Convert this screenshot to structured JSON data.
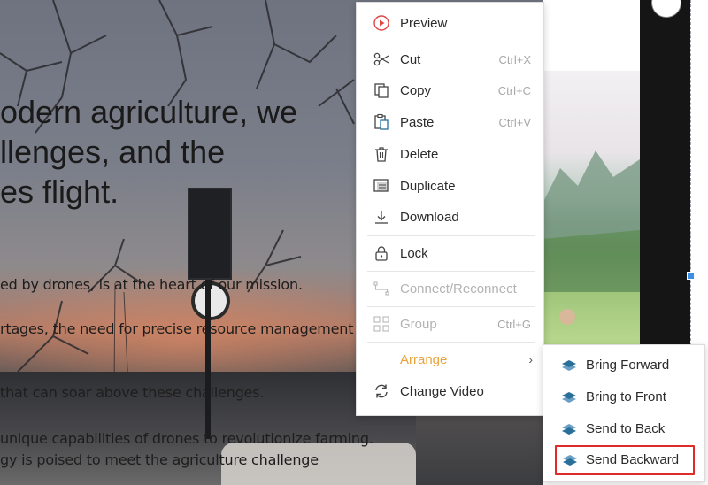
{
  "background": {
    "headline": [
      "odern agriculture, we",
      "llenges, and the",
      "es flight."
    ],
    "paragraphs": [
      "ed by drones, is at the heart of our mission.",
      "rtages, the need for precise resource management",
      " that can soar above these challenges.",
      "unique capabilities of drones to revolutionize farming.",
      "gy is poised to meet the agriculture challenge"
    ]
  },
  "context_menu": {
    "items": [
      {
        "label": "Preview",
        "icon": "play-circle-icon"
      },
      {
        "label": "Cut",
        "shortcut": "Ctrl+X",
        "icon": "scissors-icon"
      },
      {
        "label": "Copy",
        "shortcut": "Ctrl+C",
        "icon": "copy-icon"
      },
      {
        "label": "Paste",
        "shortcut": "Ctrl+V",
        "icon": "paste-icon"
      },
      {
        "label": "Delete",
        "icon": "trash-icon"
      },
      {
        "label": "Duplicate",
        "icon": "duplicate-icon"
      },
      {
        "label": "Download",
        "icon": "download-icon"
      },
      {
        "label": "Lock",
        "icon": "lock-icon"
      },
      {
        "label": "Connect/Reconnect",
        "icon": "connect-icon",
        "disabled": true
      },
      {
        "label": "Group",
        "shortcut": "Ctrl+G",
        "icon": "group-icon",
        "disabled": true
      },
      {
        "label": "Arrange",
        "icon": "none",
        "submenu": true
      },
      {
        "label": "Change Video",
        "icon": "refresh-icon"
      }
    ]
  },
  "arrange_submenu": {
    "items": [
      {
        "label": "Bring Forward",
        "icon": "layers-icon"
      },
      {
        "label": "Bring to Front",
        "icon": "layers-icon"
      },
      {
        "label": "Send to Back",
        "icon": "layers-icon"
      },
      {
        "label": "Send Backward",
        "icon": "layers-icon",
        "highlighted": true
      }
    ]
  },
  "colors": {
    "accent": "#e8a23a",
    "highlight_border": "#e02b2b",
    "preview_icon": "#e04848",
    "layer_icon": "#2a6f9a"
  }
}
